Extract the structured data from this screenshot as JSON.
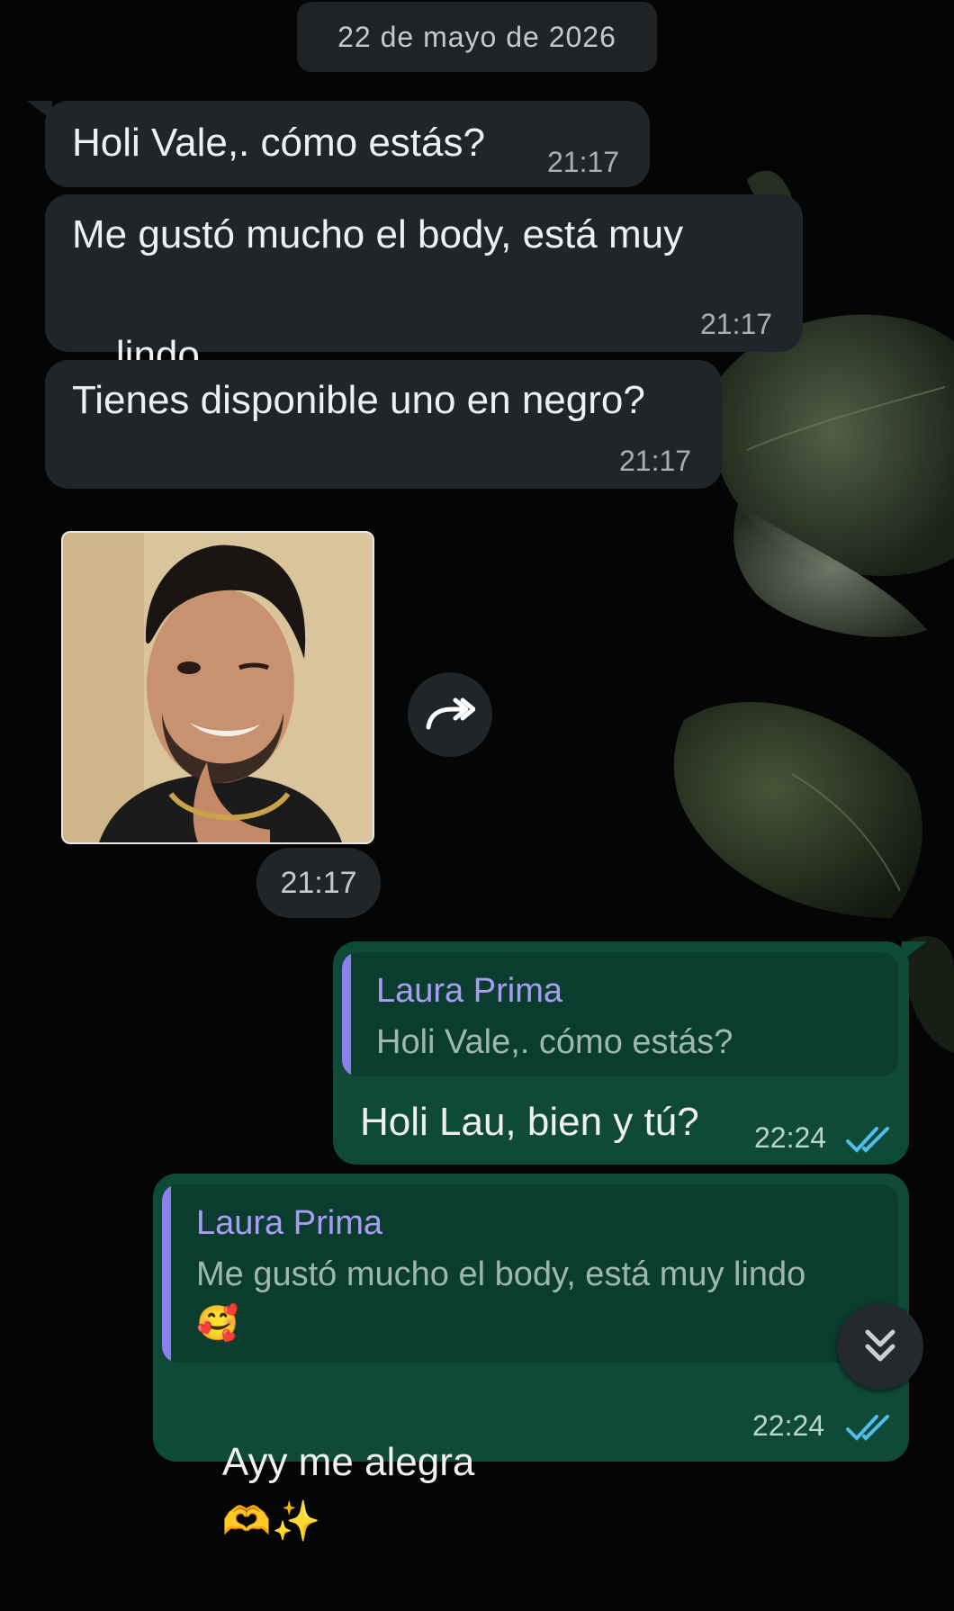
{
  "date_separator": "22 de mayo de 2026",
  "incoming": [
    {
      "text": "Holi Vale,. cómo estás?",
      "time": "21:17"
    },
    {
      "text": "Me gustó mucho el body, está muy",
      "text2": "lindo",
      "emoji": "🥰",
      "time": "21:17"
    },
    {
      "text": "Tienes disponible uno en negro?",
      "time": "21:17"
    }
  ],
  "photo_message": {
    "time": "21:17",
    "forward_icon": "forward-icon"
  },
  "outgoing": [
    {
      "quote_author": "Laura Prima",
      "quote_text": "Holi Vale,. cómo estás?",
      "text": "Holi Lau, bien y tú?",
      "time": "22:24",
      "status": "read-double-check"
    },
    {
      "quote_author": "Laura Prima",
      "quote_text": "Me gustó mucho el body, está muy lindo",
      "quote_emoji": "🥰",
      "text": "Ayy me alegra",
      "emojis": "🫶✨",
      "time": "22:24",
      "status": "read-double-check"
    }
  ],
  "colors": {
    "incoming_bubble": "#1f2528",
    "outgoing_bubble": "#0f4a38",
    "quote_bar": "#8b7ff0",
    "read_check": "#53bdeb"
  },
  "scroll_down_icon": "double-chevron-down-icon"
}
